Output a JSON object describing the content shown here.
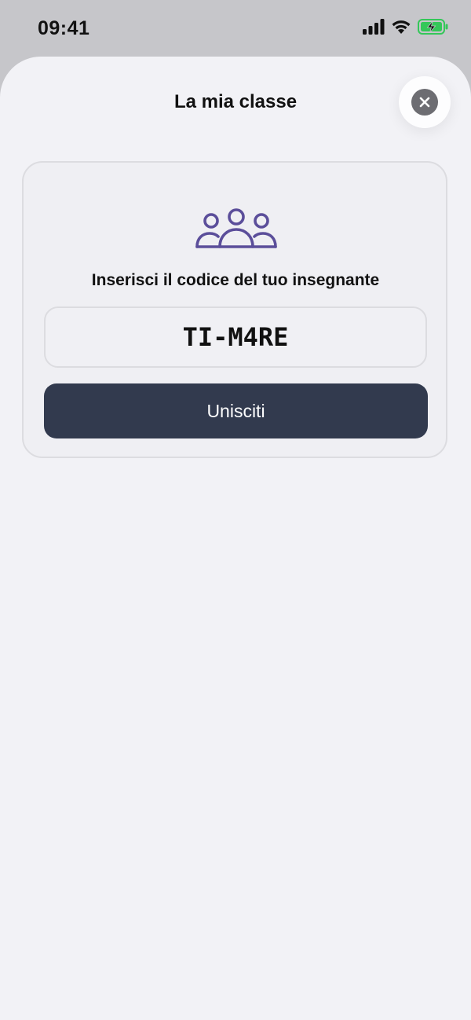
{
  "status_bar": {
    "time": "09:41",
    "icons": [
      "cellular-signal-icon",
      "wifi-icon",
      "battery-charging-icon"
    ]
  },
  "sheet": {
    "title": "La mia classe",
    "close_icon": "close-icon"
  },
  "join_card": {
    "icon": "people-group-icon",
    "label": "Inserisci il codice del tuo insegnante",
    "code_value": "TI-M4RE",
    "join_label": "Unisciti"
  },
  "colors": {
    "accent_icon": "#5b4e9a",
    "button_bg": "#323a4e",
    "battery_green": "#34c759",
    "sheet_bg": "#f2f2f6"
  }
}
